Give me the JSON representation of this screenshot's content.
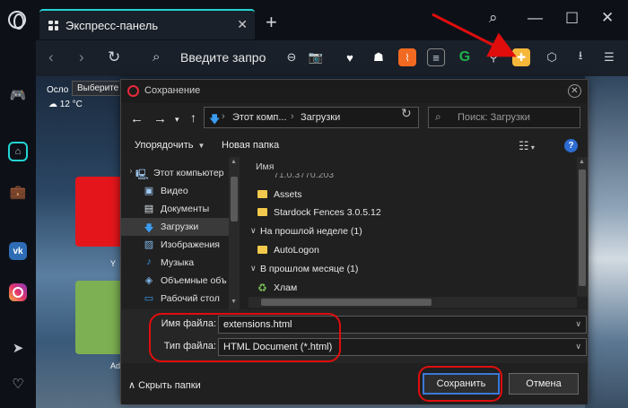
{
  "browser": {
    "tab_title": "Экспресс-панель",
    "address_placeholder": "Введите запро",
    "extension_icons": [
      "vpn-heart-icon",
      "pocket-icon",
      "rss-icon",
      "reader-icon",
      "grammarly-icon",
      "search-ext-icon",
      "puzzle-icon",
      "cube-icon",
      "download-icon",
      "settings-sliders-icon"
    ]
  },
  "speed_dial": {
    "weather_city": "Осло",
    "weather_temp": "12 °C",
    "tooltip": "Выберите с",
    "tile_label_1": "Y",
    "tile_label_2": "Ad"
  },
  "dialog": {
    "title": "Сохранение",
    "path": [
      "Этот комп...",
      "Загрузки"
    ],
    "search_placeholder": "Поиск: Загрузки",
    "toolbar": {
      "organize": "Упорядочить",
      "new_folder": "Новая папка"
    },
    "tree": [
      {
        "label": "Этот компьютер",
        "icon": "computer-icon"
      },
      {
        "label": "Видео",
        "icon": "video-icon"
      },
      {
        "label": "Документы",
        "icon": "documents-icon"
      },
      {
        "label": "Загрузки",
        "icon": "downloads-icon",
        "selected": true
      },
      {
        "label": "Изображения",
        "icon": "images-icon"
      },
      {
        "label": "Музыка",
        "icon": "music-icon"
      },
      {
        "label": "Объемные объ",
        "icon": "3d-objects-icon"
      },
      {
        "label": "Рабочий стол",
        "icon": "desktop-icon"
      }
    ],
    "column_name": "Имя",
    "files": {
      "cut_row": "71.0.3770.203",
      "row1": "Assets",
      "row2": "Stardock Fences 3.0.5.12",
      "group1": "На прошлой неделе (1)",
      "row3": "AutoLogon",
      "group2": "В прошлом месяце (1)",
      "row4": "Хлам"
    },
    "filename_label": "Имя файла:",
    "filename_value": "extensions.html",
    "filetype_label": "Тип файла:",
    "filetype_value": "HTML Document (*.html)",
    "hide_folders": "Скрыть папки",
    "save_button": "Сохранить",
    "cancel_button": "Отмена"
  },
  "colors": {
    "accent": "#23d3d3",
    "annotation_red": "#e00d0d",
    "primary_button_border": "#3b78d8"
  }
}
